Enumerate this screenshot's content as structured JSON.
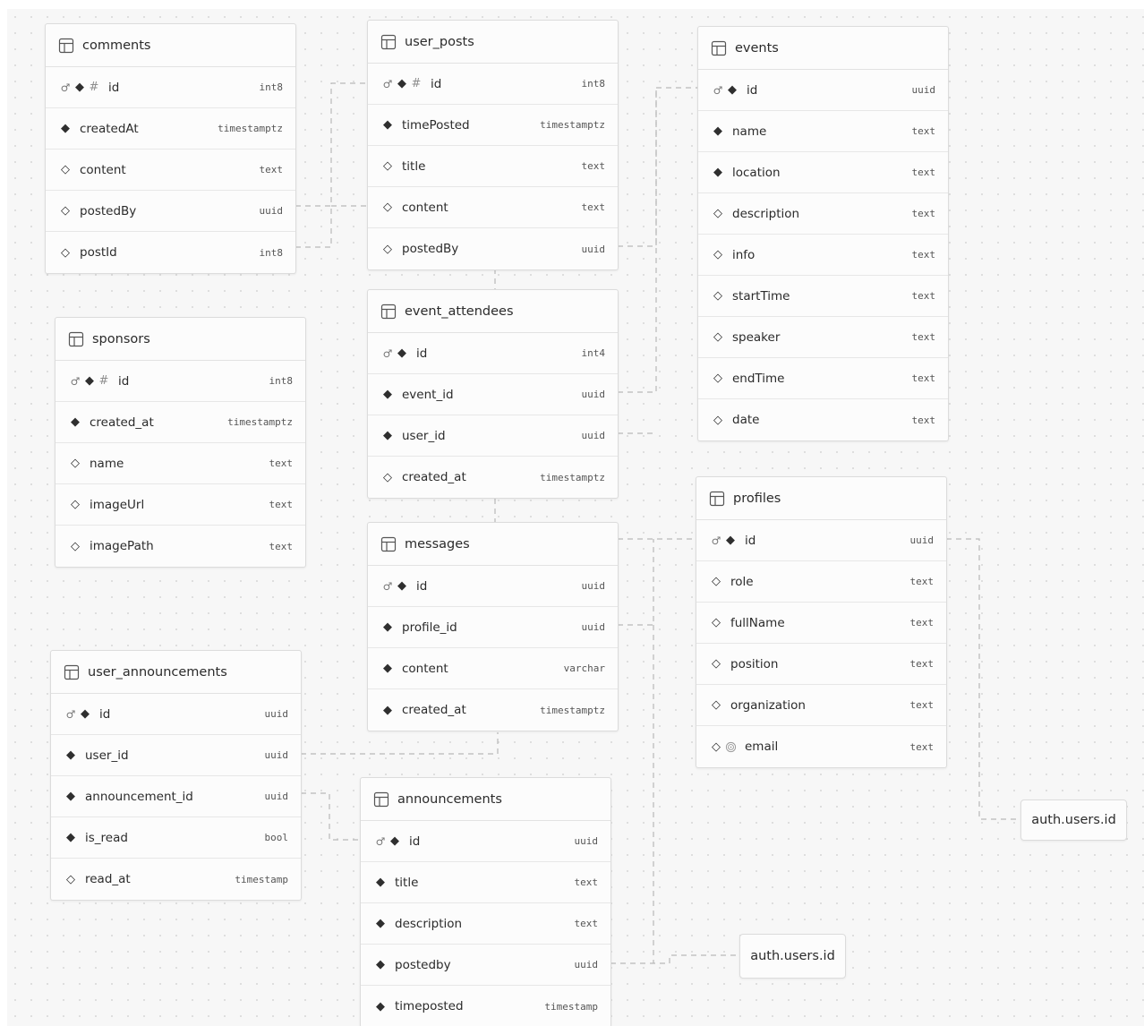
{
  "tables": [
    {
      "name": "comments",
      "columns": [
        {
          "name": "id",
          "type": "int8",
          "icons": [
            "key",
            "pk",
            "identity"
          ]
        },
        {
          "name": "createdAt",
          "type": "timestamptz",
          "icons": [
            "required"
          ]
        },
        {
          "name": "content",
          "type": "text",
          "icons": [
            "optional"
          ]
        },
        {
          "name": "postedBy",
          "type": "uuid",
          "icons": [
            "optional"
          ]
        },
        {
          "name": "postId",
          "type": "int8",
          "icons": [
            "optional"
          ]
        }
      ]
    },
    {
      "name": "user_posts",
      "columns": [
        {
          "name": "id",
          "type": "int8",
          "icons": [
            "key",
            "pk",
            "identity"
          ]
        },
        {
          "name": "timePosted",
          "type": "timestamptz",
          "icons": [
            "required"
          ]
        },
        {
          "name": "title",
          "type": "text",
          "icons": [
            "optional"
          ]
        },
        {
          "name": "content",
          "type": "text",
          "icons": [
            "optional"
          ]
        },
        {
          "name": "postedBy",
          "type": "uuid",
          "icons": [
            "optional"
          ]
        }
      ]
    },
    {
      "name": "events",
      "columns": [
        {
          "name": "id",
          "type": "uuid",
          "icons": [
            "key",
            "pk"
          ]
        },
        {
          "name": "name",
          "type": "text",
          "icons": [
            "required"
          ]
        },
        {
          "name": "location",
          "type": "text",
          "icons": [
            "required"
          ]
        },
        {
          "name": "description",
          "type": "text",
          "icons": [
            "optional"
          ]
        },
        {
          "name": "info",
          "type": "text",
          "icons": [
            "optional"
          ]
        },
        {
          "name": "startTime",
          "type": "text",
          "icons": [
            "optional"
          ]
        },
        {
          "name": "speaker",
          "type": "text",
          "icons": [
            "optional"
          ]
        },
        {
          "name": "endTime",
          "type": "text",
          "icons": [
            "optional"
          ]
        },
        {
          "name": "date",
          "type": "text",
          "icons": [
            "optional"
          ]
        }
      ]
    },
    {
      "name": "sponsors",
      "columns": [
        {
          "name": "id",
          "type": "int8",
          "icons": [
            "key",
            "pk",
            "identity"
          ]
        },
        {
          "name": "created_at",
          "type": "timestamptz",
          "icons": [
            "required"
          ]
        },
        {
          "name": "name",
          "type": "text",
          "icons": [
            "optional"
          ]
        },
        {
          "name": "imageUrl",
          "type": "text",
          "icons": [
            "optional"
          ]
        },
        {
          "name": "imagePath",
          "type": "text",
          "icons": [
            "optional"
          ]
        }
      ]
    },
    {
      "name": "event_attendees",
      "columns": [
        {
          "name": "id",
          "type": "int4",
          "icons": [
            "key",
            "pk"
          ]
        },
        {
          "name": "event_id",
          "type": "uuid",
          "icons": [
            "required"
          ]
        },
        {
          "name": "user_id",
          "type": "uuid",
          "icons": [
            "required"
          ]
        },
        {
          "name": "created_at",
          "type": "timestamptz",
          "icons": [
            "optional"
          ]
        }
      ]
    },
    {
      "name": "profiles",
      "columns": [
        {
          "name": "id",
          "type": "uuid",
          "icons": [
            "key",
            "pk"
          ]
        },
        {
          "name": "role",
          "type": "text",
          "icons": [
            "optional"
          ]
        },
        {
          "name": "fullName",
          "type": "text",
          "icons": [
            "optional"
          ]
        },
        {
          "name": "position",
          "type": "text",
          "icons": [
            "optional"
          ]
        },
        {
          "name": "organization",
          "type": "text",
          "icons": [
            "optional"
          ]
        },
        {
          "name": "email",
          "type": "text",
          "icons": [
            "optional",
            "unique"
          ]
        }
      ]
    },
    {
      "name": "messages",
      "columns": [
        {
          "name": "id",
          "type": "uuid",
          "icons": [
            "key",
            "pk"
          ]
        },
        {
          "name": "profile_id",
          "type": "uuid",
          "icons": [
            "required"
          ]
        },
        {
          "name": "content",
          "type": "varchar",
          "icons": [
            "required"
          ]
        },
        {
          "name": "created_at",
          "type": "timestamptz",
          "icons": [
            "required"
          ]
        }
      ]
    },
    {
      "name": "user_announcements",
      "columns": [
        {
          "name": "id",
          "type": "uuid",
          "icons": [
            "key",
            "pk"
          ]
        },
        {
          "name": "user_id",
          "type": "uuid",
          "icons": [
            "required"
          ]
        },
        {
          "name": "announcement_id",
          "type": "uuid",
          "icons": [
            "required"
          ]
        },
        {
          "name": "is_read",
          "type": "bool",
          "icons": [
            "required"
          ]
        },
        {
          "name": "read_at",
          "type": "timestamp",
          "icons": [
            "optional"
          ]
        }
      ]
    },
    {
      "name": "announcements",
      "columns": [
        {
          "name": "id",
          "type": "uuid",
          "icons": [
            "key",
            "pk"
          ]
        },
        {
          "name": "title",
          "type": "text",
          "icons": [
            "required"
          ]
        },
        {
          "name": "description",
          "type": "text",
          "icons": [
            "required"
          ]
        },
        {
          "name": "postedby",
          "type": "uuid",
          "icons": [
            "required"
          ]
        },
        {
          "name": "timeposted",
          "type": "timestamp",
          "icons": [
            "required"
          ]
        }
      ]
    }
  ],
  "refs": [
    {
      "label": "auth.users.id"
    },
    {
      "label": "auth.users.id"
    }
  ],
  "colors": {
    "line": "#b8b8b8",
    "text": "#2b2b2b",
    "type": "#555555",
    "border": "#dcdcdc",
    "canvas": "#f7f7f7"
  }
}
